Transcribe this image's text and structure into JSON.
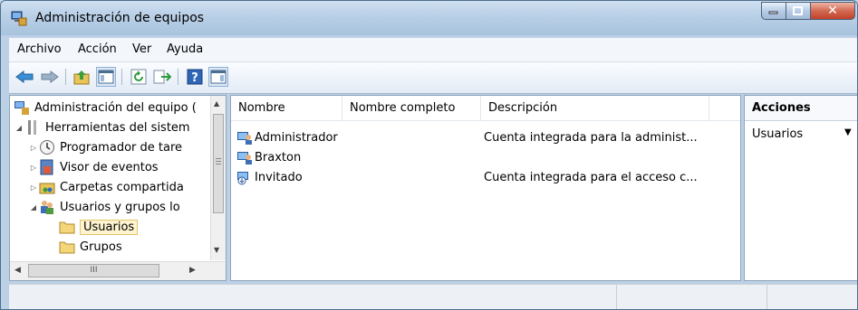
{
  "window": {
    "title": "Administración de equipos",
    "icon": "computer-management-icon"
  },
  "menu": [
    "Archivo",
    "Acción",
    "Ver",
    "Ayuda"
  ],
  "toolbar": {
    "buttons": [
      "back-arrow-icon",
      "forward-arrow-icon",
      "up-folder-icon",
      "show-hide-tree-icon",
      "refresh-icon",
      "export-list-icon",
      "help-icon",
      "show-hide-action-pane-icon"
    ]
  },
  "tree": {
    "items": [
      {
        "label": "Administración del equipo (",
        "icon": "computer-management-icon",
        "expander": ""
      },
      {
        "label": "Herramientas del sistem",
        "icon": "tools-icon",
        "expander": "◢"
      },
      {
        "label": "Programador de tare",
        "icon": "clock-icon",
        "expander": "▷"
      },
      {
        "label": "Visor de eventos",
        "icon": "event-viewer-icon",
        "expander": "▷"
      },
      {
        "label": "Carpetas compartida",
        "icon": "shared-folders-icon",
        "expander": "▷"
      },
      {
        "label": "Usuarios y grupos lo",
        "icon": "users-groups-icon",
        "expander": "◢"
      },
      {
        "label": "Usuarios",
        "icon": "folder-icon",
        "expander": ""
      },
      {
        "label": "Grupos",
        "icon": "folder-icon",
        "expander": ""
      }
    ]
  },
  "list": {
    "columns": [
      "Nombre",
      "Nombre completo",
      "Descripción"
    ],
    "rows": [
      {
        "name": "Administrador",
        "full_name": "",
        "description": "Cuenta integrada para la administ...",
        "icon": "user-icon"
      },
      {
        "name": "Braxton",
        "full_name": "",
        "description": "",
        "icon": "user-icon"
      },
      {
        "name": "Invitado",
        "full_name": "",
        "description": "Cuenta integrada para el acceso c...",
        "icon": "disabled-user-icon"
      }
    ]
  },
  "actions": {
    "header": "Acciones",
    "item": "Usuarios"
  },
  "hscroll_thumb": "III"
}
